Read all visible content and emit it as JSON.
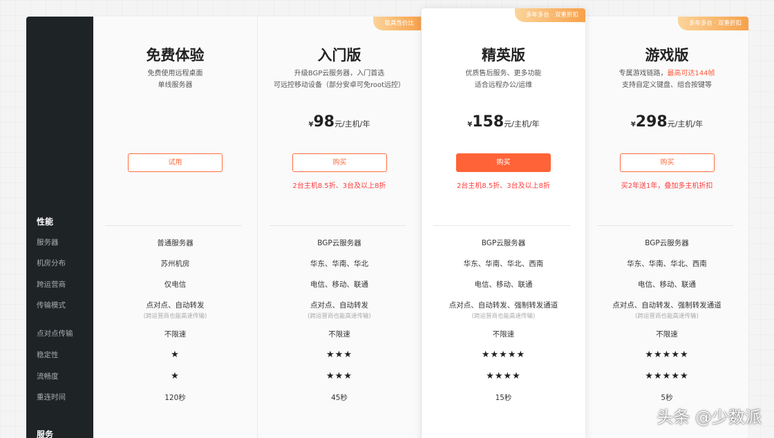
{
  "sidebar": {
    "performance_label": "性能",
    "rows": [
      "服务器",
      "机房分布",
      "跨运营商",
      "传输模式",
      "点对点传输",
      "稳定性",
      "流畅度",
      "重连时间"
    ],
    "service_label": "服务"
  },
  "plans": [
    {
      "title": "免费体验",
      "desc1": "免费使用远程桌面",
      "desc2": "单线服务器",
      "button": "试用",
      "rows": [
        "普通服务器",
        "苏州机房",
        "仅电信",
        "点对点、自动转发",
        "不限速",
        "★",
        "★",
        "120秒"
      ],
      "sub": "(跨运营商也能高速传输)"
    },
    {
      "ribbon": "极具性价比",
      "title": "入门版",
      "desc1": "升级BGP云服务器，入门首选",
      "desc2": "可远控移动设备（部分安卓可免root远控）",
      "price_currency": "¥",
      "price_value": "98",
      "price_unit": "元/主机/年",
      "button": "购买",
      "promo": "2台主机8.5折、3台及以上8折",
      "rows": [
        "BGP云服务器",
        "华东、华南、华北",
        "电信、移动、联通",
        "点对点、自动转发",
        "不限速",
        "★★★",
        "★★★",
        "45秒"
      ],
      "sub": "(跨运营商也能高速传输)"
    },
    {
      "ribbon": "多年多台 · 双重折扣",
      "title": "精英版",
      "desc1": "优质售后服务、更多功能",
      "desc2": "适合远程办公/运维",
      "price_currency": "¥",
      "price_value": "158",
      "price_unit": "元/主机/年",
      "button": "购买",
      "promo": "2台主机8.5折、3台及以上8折",
      "rows": [
        "BGP云服务器",
        "华东、华南、华北、西南",
        "电信、移动、联通",
        "点对点、自动转发、强制转发通道",
        "不限速",
        "★★★★★",
        "★★★★",
        "15秒"
      ],
      "sub": "(跨运营商也能高速传输)"
    },
    {
      "ribbon": "多年多台 · 双重折扣",
      "title": "游戏版",
      "desc1_pre": "专属游戏链路，",
      "desc1_hl": "最高可达144帧",
      "desc2": "支持自定义键盘、组合按键等",
      "price_currency": "¥",
      "price_value": "298",
      "price_unit": "元/主机/年",
      "button": "购买",
      "promo": "买2年送1年，叠加多主机折扣",
      "rows": [
        "BGP云服务器",
        "华东、华南、华北、西南",
        "电信、移动、联通",
        "点对点、自动转发、强制转发通道",
        "不限速",
        "★★★★★",
        "★★★★★",
        "5秒"
      ],
      "sub": "(跨运营商也能高速传输)"
    }
  ],
  "watermark": "头条 @少数派",
  "colors": {
    "accent": "#ff6337",
    "promo": "#ff3c3c",
    "sidebar_bg": "#1e2326",
    "ribbon": "#f7a14a"
  }
}
